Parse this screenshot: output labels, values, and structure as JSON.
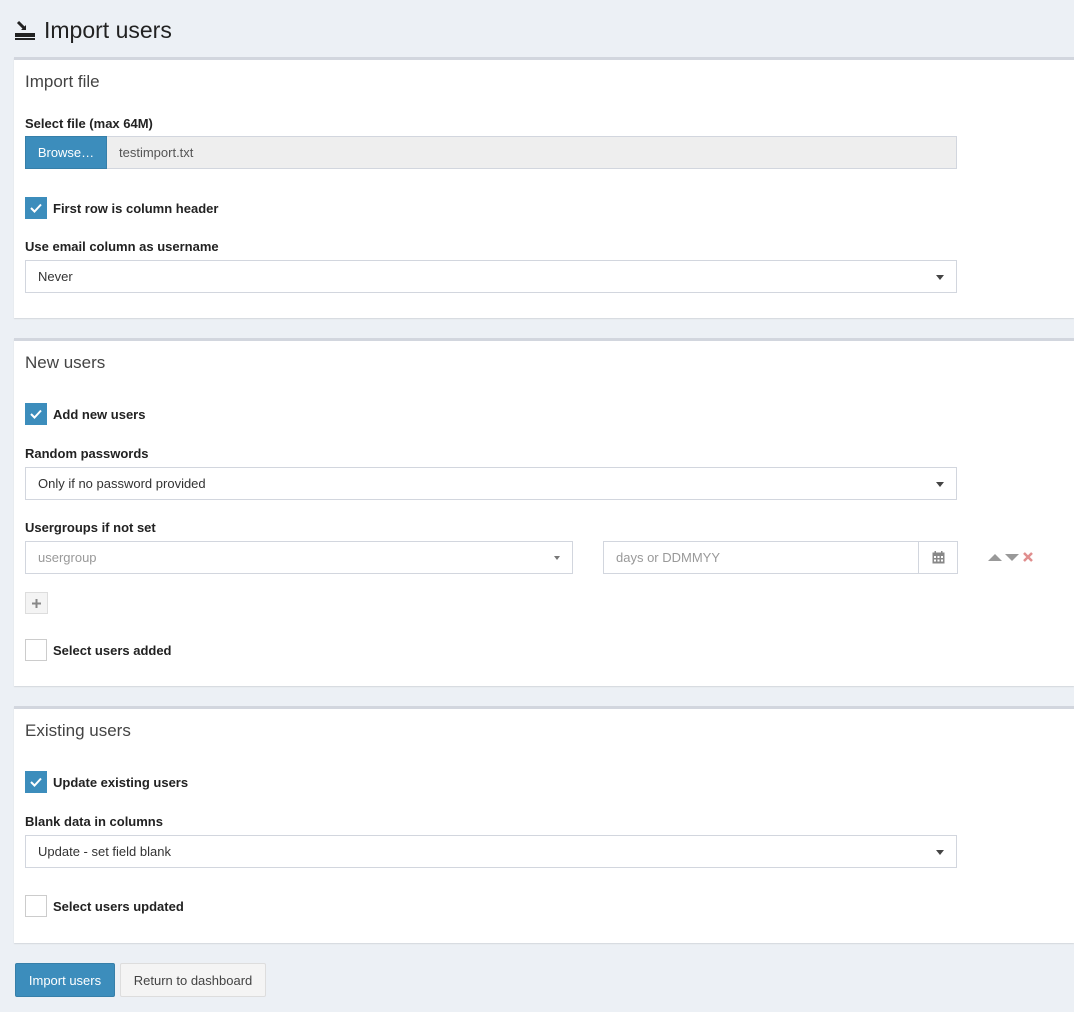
{
  "page": {
    "title": "Import users",
    "icon": "import-icon"
  },
  "import_file": {
    "title": "Import file",
    "file_label": "Select file (max 64M)",
    "browse_label": "Browse…",
    "file_name": "testimport.txt",
    "first_row_header": {
      "label": "First row is column header",
      "checked": true
    },
    "email_username": {
      "label": "Use email column as username",
      "value": "Never"
    }
  },
  "new_users": {
    "title": "New users",
    "add_new": {
      "label": "Add new users",
      "checked": true
    },
    "random_passwords": {
      "label": "Random passwords",
      "value": "Only if no password provided"
    },
    "usergroups": {
      "label": "Usergroups if not set",
      "usergroup_placeholder": "usergroup",
      "date_placeholder": "days or DDMMYY",
      "icons": [
        "calendar-icon",
        "arrow-up-icon",
        "arrow-down-icon",
        "remove-icon",
        "plus-icon"
      ]
    },
    "select_added": {
      "label": "Select users added",
      "checked": false
    }
  },
  "existing_users": {
    "title": "Existing users",
    "update_existing": {
      "label": "Update existing users",
      "checked": true
    },
    "blank_data": {
      "label": "Blank data in columns",
      "value": "Update - set field blank"
    },
    "select_updated": {
      "label": "Select users updated",
      "checked": false
    }
  },
  "footer": {
    "import_button": "Import users",
    "return_button": "Return to dashboard"
  },
  "colors": {
    "primary": "#3c8dbc",
    "background": "#ecf0f5",
    "remove": "#e08e8e"
  }
}
